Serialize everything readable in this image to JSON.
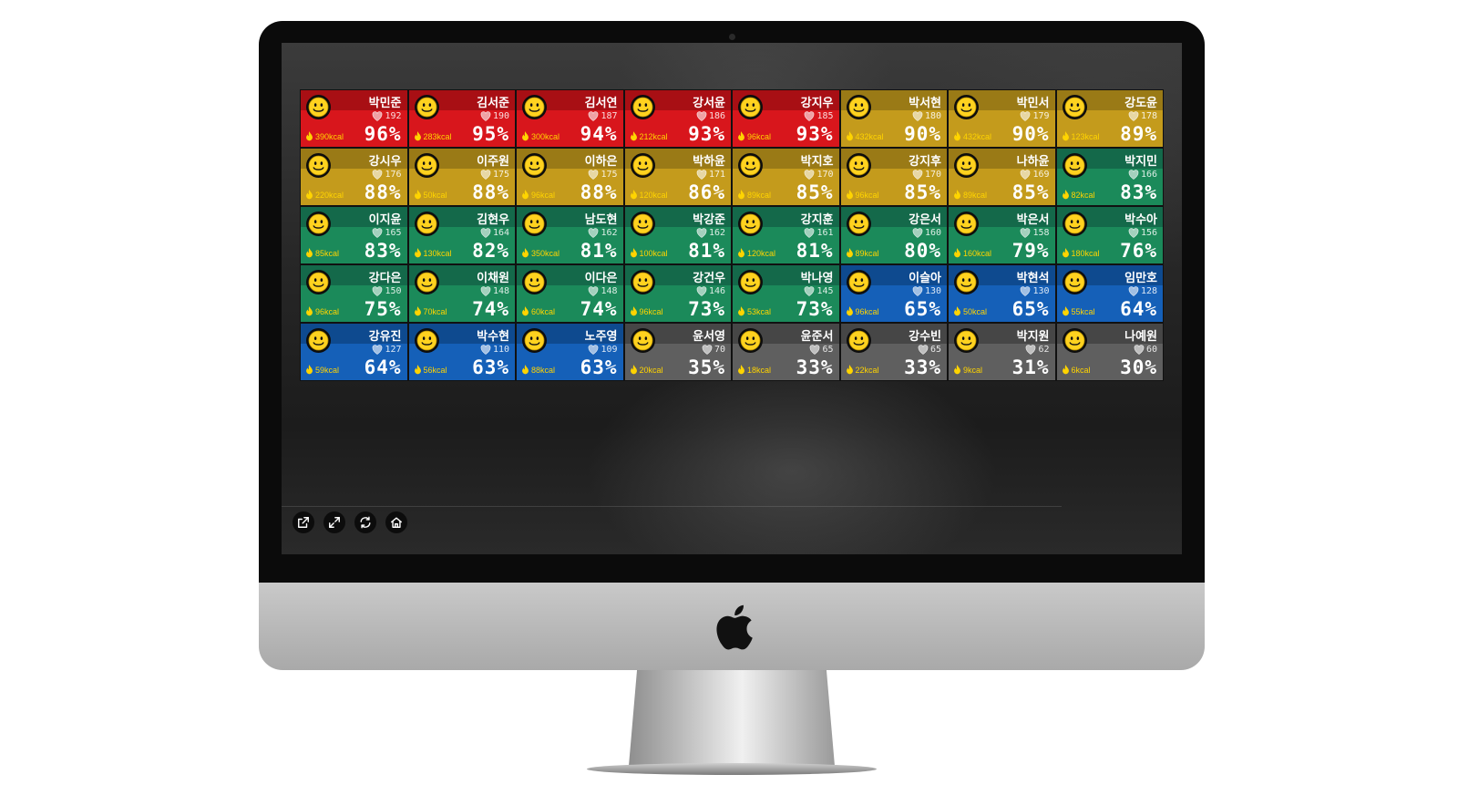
{
  "colors": {
    "red": "#d8161c",
    "red_band": "#a80f14",
    "gold": "#c49b1c",
    "gold_band": "#9a7a16",
    "green": "#1b8a5a",
    "green_band": "#14694a",
    "blue": "#1560b8",
    "blue_band": "#0e4a8f",
    "gray": "#5f5f5f",
    "gray_band": "#464646",
    "kcal": "#ffd400"
  },
  "icons": {
    "avatar": "smiley-icon",
    "heart_rate": "heart-icon",
    "calories": "flame-icon"
  },
  "participants": [
    {
      "name": "박민준",
      "hr": "192",
      "kcal": "390kcal",
      "pct": "96%",
      "zone": "red"
    },
    {
      "name": "김서준",
      "hr": "190",
      "kcal": "283kcal",
      "pct": "95%",
      "zone": "red"
    },
    {
      "name": "김서연",
      "hr": "187",
      "kcal": "300kcal",
      "pct": "94%",
      "zone": "red"
    },
    {
      "name": "강서윤",
      "hr": "186",
      "kcal": "212kcal",
      "pct": "93%",
      "zone": "red"
    },
    {
      "name": "강지우",
      "hr": "185",
      "kcal": "96kcal",
      "pct": "93%",
      "zone": "red"
    },
    {
      "name": "박서현",
      "hr": "180",
      "kcal": "432kcal",
      "pct": "90%",
      "zone": "gold"
    },
    {
      "name": "박민서",
      "hr": "179",
      "kcal": "432kcal",
      "pct": "90%",
      "zone": "gold"
    },
    {
      "name": "강도윤",
      "hr": "178",
      "kcal": "123kcal",
      "pct": "89%",
      "zone": "gold"
    },
    {
      "name": "강시우",
      "hr": "176",
      "kcal": "220kcal",
      "pct": "88%",
      "zone": "gold"
    },
    {
      "name": "이주원",
      "hr": "175",
      "kcal": "50kcal",
      "pct": "88%",
      "zone": "gold"
    },
    {
      "name": "이하은",
      "hr": "175",
      "kcal": "96kcal",
      "pct": "88%",
      "zone": "gold"
    },
    {
      "name": "박하윤",
      "hr": "171",
      "kcal": "120kcal",
      "pct": "86%",
      "zone": "gold"
    },
    {
      "name": "박지호",
      "hr": "170",
      "kcal": "89kcal",
      "pct": "85%",
      "zone": "gold"
    },
    {
      "name": "강지후",
      "hr": "170",
      "kcal": "96kcal",
      "pct": "85%",
      "zone": "gold"
    },
    {
      "name": "나하윤",
      "hr": "169",
      "kcal": "89kcal",
      "pct": "85%",
      "zone": "gold"
    },
    {
      "name": "박지민",
      "hr": "166",
      "kcal": "82kcal",
      "pct": "83%",
      "zone": "green"
    },
    {
      "name": "이지윤",
      "hr": "165",
      "kcal": "85kcal",
      "pct": "83%",
      "zone": "green"
    },
    {
      "name": "김현우",
      "hr": "164",
      "kcal": "130kcal",
      "pct": "82%",
      "zone": "green"
    },
    {
      "name": "남도현",
      "hr": "162",
      "kcal": "350kcal",
      "pct": "81%",
      "zone": "green"
    },
    {
      "name": "박강준",
      "hr": "162",
      "kcal": "100kcal",
      "pct": "81%",
      "zone": "green"
    },
    {
      "name": "강지훈",
      "hr": "161",
      "kcal": "120kcal",
      "pct": "81%",
      "zone": "green"
    },
    {
      "name": "강은서",
      "hr": "160",
      "kcal": "89kcal",
      "pct": "80%",
      "zone": "green"
    },
    {
      "name": "박은서",
      "hr": "158",
      "kcal": "160kcal",
      "pct": "79%",
      "zone": "green"
    },
    {
      "name": "박수아",
      "hr": "156",
      "kcal": "180kcal",
      "pct": "76%",
      "zone": "green"
    },
    {
      "name": "강다은",
      "hr": "150",
      "kcal": "96kcal",
      "pct": "75%",
      "zone": "green"
    },
    {
      "name": "이채원",
      "hr": "148",
      "kcal": "70kcal",
      "pct": "74%",
      "zone": "green"
    },
    {
      "name": "이다은",
      "hr": "148",
      "kcal": "60kcal",
      "pct": "74%",
      "zone": "green"
    },
    {
      "name": "강건우",
      "hr": "146",
      "kcal": "96kcal",
      "pct": "73%",
      "zone": "green"
    },
    {
      "name": "박나영",
      "hr": "145",
      "kcal": "53kcal",
      "pct": "73%",
      "zone": "green"
    },
    {
      "name": "이슬아",
      "hr": "130",
      "kcal": "96kcal",
      "pct": "65%",
      "zone": "blue"
    },
    {
      "name": "박현석",
      "hr": "130",
      "kcal": "50kcal",
      "pct": "65%",
      "zone": "blue"
    },
    {
      "name": "임만호",
      "hr": "128",
      "kcal": "55kcal",
      "pct": "64%",
      "zone": "blue"
    },
    {
      "name": "강유진",
      "hr": "127",
      "kcal": "59kcal",
      "pct": "64%",
      "zone": "blue"
    },
    {
      "name": "박수현",
      "hr": "110",
      "kcal": "56kcal",
      "pct": "63%",
      "zone": "blue"
    },
    {
      "name": "노주영",
      "hr": "109",
      "kcal": "88kcal",
      "pct": "63%",
      "zone": "blue"
    },
    {
      "name": "윤서영",
      "hr": "70",
      "kcal": "20kcal",
      "pct": "35%",
      "zone": "gray"
    },
    {
      "name": "윤준서",
      "hr": "65",
      "kcal": "18kcal",
      "pct": "33%",
      "zone": "gray"
    },
    {
      "name": "강수빈",
      "hr": "65",
      "kcal": "22kcal",
      "pct": "33%",
      "zone": "gray"
    },
    {
      "name": "박지원",
      "hr": "62",
      "kcal": "9kcal",
      "pct": "31%",
      "zone": "gray"
    },
    {
      "name": "나예원",
      "hr": "60",
      "kcal": "6kcal",
      "pct": "30%",
      "zone": "gray"
    }
  ],
  "toolbar": [
    {
      "name": "open-external-button",
      "icon": "external-link-icon"
    },
    {
      "name": "fullscreen-button",
      "icon": "expand-icon"
    },
    {
      "name": "refresh-button",
      "icon": "refresh-icon"
    },
    {
      "name": "home-button",
      "icon": "home-icon"
    }
  ]
}
